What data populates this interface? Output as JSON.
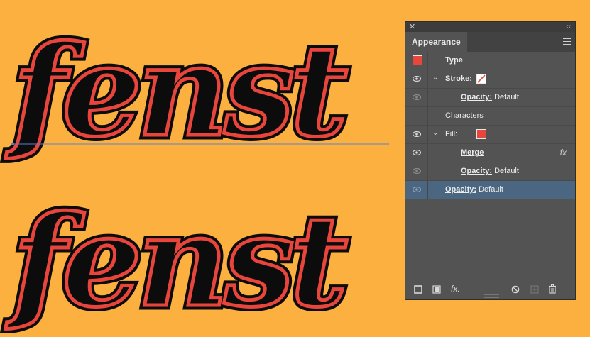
{
  "artwork": {
    "word_top": "fenst",
    "word_bottom": "fenst",
    "fill_color": "#0c0c0c",
    "stroke_color": "#E8453C",
    "guide_color": "#5b7fd1"
  },
  "panel": {
    "title": "Appearance",
    "rows": [
      {
        "label": "Type"
      },
      {
        "label": "Stroke:"
      },
      {
        "label": "Opacity:",
        "value": "Default"
      },
      {
        "label": "Characters"
      },
      {
        "label": "Fill:"
      },
      {
        "label": "Merge",
        "fx": "fx"
      },
      {
        "label": "Opacity:",
        "value": "Default"
      },
      {
        "label": "Opacity:",
        "value": "Default"
      }
    ],
    "footer": {
      "fx_label": "fx."
    },
    "colors": {
      "panel_bg": "#535353",
      "selected_row": "#4A6680",
      "swatch_red": "#E8453C"
    }
  }
}
